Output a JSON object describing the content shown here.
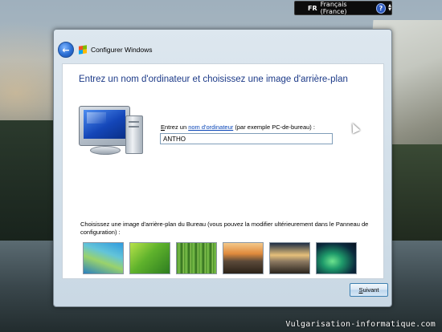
{
  "language_bar": {
    "code": "FR",
    "language": "Français (France)",
    "help_symbol": "?"
  },
  "window": {
    "title": "Configurer Windows",
    "back_symbol": "←"
  },
  "page": {
    "heading": "Entrez un nom d'ordinateur et choisissez une image d'arrière-plan",
    "name_label_prefix_ul": "E",
    "name_label_rest": "ntrez un ",
    "name_label_link": "nom d'ordinateur",
    "name_label_suffix": " (par exemple PC-de-bureau) :",
    "computer_name_value": "ANTHO",
    "background_label": "Choisissez une image d'arrière-plan du Bureau (vous pouvez la modifier ultérieurement dans le Panneau de configuration) :",
    "backgrounds": [
      "aurora-blue-wave",
      "green-leaf",
      "green-bamboo",
      "sunset-field",
      "mountain-dusk",
      "northern-lights"
    ]
  },
  "footer": {
    "next_ul": "S",
    "next_rest": "uivant"
  },
  "watermark": "Vulgarisation-informatique.com"
}
